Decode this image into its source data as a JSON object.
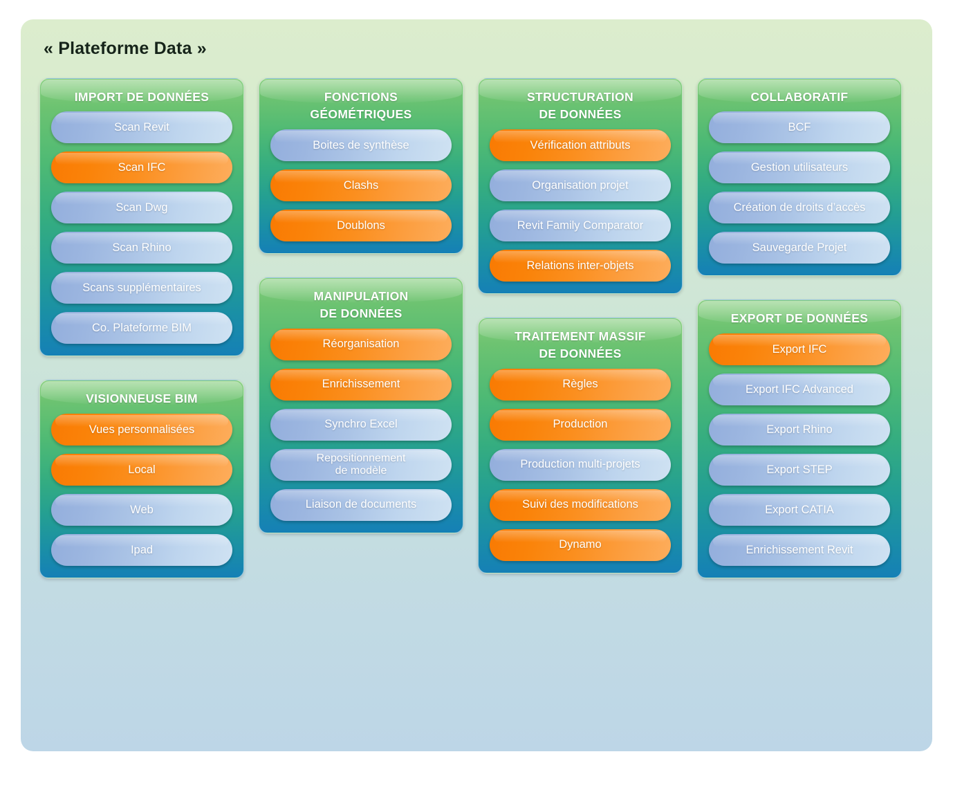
{
  "title": "« Plateforme  Data »",
  "colors": {
    "accent_orange": "#f9820a",
    "accent_blue": "#a8c2e4",
    "card_green_top": "#86ce7d",
    "card_blue_bottom": "#1580b6",
    "panel_top": "#dcedcd",
    "panel_bottom": "#bdd6e7"
  },
  "columns": [
    {
      "cards": [
        {
          "title": "IMPORT DE DONNÉES",
          "items": [
            {
              "label": "Scan Revit",
              "color": "blue"
            },
            {
              "label": "Scan IFC",
              "color": "orange"
            },
            {
              "label": "Scan Dwg",
              "color": "blue"
            },
            {
              "label": "Scan Rhino",
              "color": "blue"
            },
            {
              "label": "Scans supplémentaires",
              "color": "blue"
            },
            {
              "label": "Co. Plateforme BIM",
              "color": "blue"
            }
          ]
        },
        {
          "title": "VISIONNEUSE BIM",
          "items": [
            {
              "label": "Vues personnalisées",
              "color": "orange"
            },
            {
              "label": "Local",
              "color": "orange"
            },
            {
              "label": "Web",
              "color": "blue"
            },
            {
              "label": "Ipad",
              "color": "blue"
            }
          ]
        }
      ]
    },
    {
      "cards": [
        {
          "title": "FONCTIONS\nGÉOMÉTRIQUES",
          "items": [
            {
              "label": "Boites de synthèse",
              "color": "blue"
            },
            {
              "label": "Clashs",
              "color": "orange"
            },
            {
              "label": "Doublons",
              "color": "orange"
            }
          ]
        },
        {
          "title": "MANIPULATION\nDE DONNÉES",
          "items": [
            {
              "label": "Réorganisation",
              "color": "orange"
            },
            {
              "label": "Enrichissement",
              "color": "orange"
            },
            {
              "label": "Synchro Excel",
              "color": "blue"
            },
            {
              "label": "Repositionnement\nde modèle",
              "color": "blue",
              "two_line": true
            },
            {
              "label": "Liaison de documents",
              "color": "blue"
            }
          ]
        }
      ]
    },
    {
      "cards": [
        {
          "title": "STRUCTURATION\nDE DONNÉES",
          "items": [
            {
              "label": "Vérification attributs",
              "color": "orange"
            },
            {
              "label": "Organisation projet",
              "color": "blue"
            },
            {
              "label": "Revit Family Comparator",
              "color": "blue"
            },
            {
              "label": "Relations inter-objets",
              "color": "orange"
            }
          ]
        },
        {
          "title": "TRAITEMENT MASSIF\nDE DONNÉES",
          "items": [
            {
              "label": "Règles",
              "color": "orange"
            },
            {
              "label": "Production",
              "color": "orange"
            },
            {
              "label": "Production multi-projets",
              "color": "blue"
            },
            {
              "label": "Suivi des modifications",
              "color": "orange"
            },
            {
              "label": "Dynamo",
              "color": "orange"
            }
          ]
        }
      ]
    },
    {
      "cards": [
        {
          "title": "COLLABORATIF",
          "items": [
            {
              "label": "BCF",
              "color": "blue"
            },
            {
              "label": "Gestion utilisateurs",
              "color": "blue"
            },
            {
              "label": "Création de droits d’accès",
              "color": "blue"
            },
            {
              "label": "Sauvegarde Projet",
              "color": "blue"
            }
          ]
        },
        {
          "title": "EXPORT DE DONNÉES",
          "items": [
            {
              "label": "Export IFC",
              "color": "orange"
            },
            {
              "label": "Export IFC Advanced",
              "color": "blue"
            },
            {
              "label": "Export Rhino",
              "color": "blue"
            },
            {
              "label": "Export STEP",
              "color": "blue"
            },
            {
              "label": "Export CATIA",
              "color": "blue"
            },
            {
              "label": "Enrichissement Revit",
              "color": "blue"
            }
          ]
        }
      ]
    }
  ]
}
